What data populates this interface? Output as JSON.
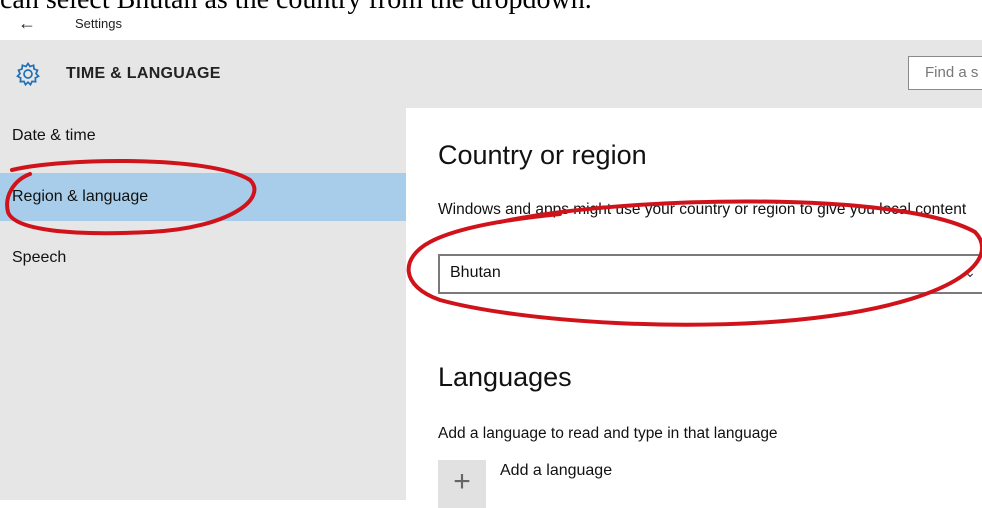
{
  "caption": "can select Bhutan as the country from the dropdown.",
  "titlebar": {
    "back_icon": "back-arrow-icon",
    "title": "Settings"
  },
  "header": {
    "icon": "gear-icon",
    "section": "TIME & LANGUAGE",
    "search_placeholder": "Find a s"
  },
  "sidebar": {
    "items": [
      {
        "label": "Date & time",
        "selected": false
      },
      {
        "label": "Region & language",
        "selected": true
      },
      {
        "label": "Speech",
        "selected": false
      }
    ]
  },
  "main": {
    "country": {
      "heading": "Country or region",
      "description": "Windows and apps might use your country or region to give you local content",
      "selected_value": "Bhutan"
    },
    "languages": {
      "heading": "Languages",
      "description": "Add a language to read and type in that language",
      "add_label": "Add a language"
    }
  },
  "annotation": {
    "color": "#d0131a"
  }
}
